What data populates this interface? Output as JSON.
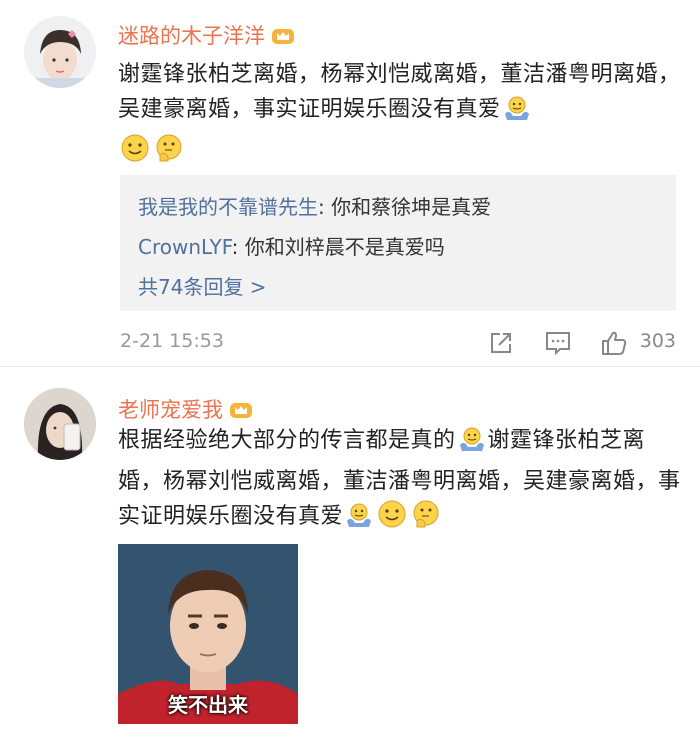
{
  "comments": [
    {
      "username": "迷路的木子洋洋",
      "text_main": "谢霆锋张柏芝离婚，杨幂刘恺威离婚，董洁潘粤明离婚，吴建豪离婚，事实证明娱乐圈没有真爱",
      "emojis": [
        "shrug-icon",
        "smile-icon",
        "thinking-icon"
      ],
      "replies": [
        {
          "name": "我是我的不靠谱先生",
          "text": ": 你和蔡徐坤是真爱"
        },
        {
          "name": "CrownLYF",
          "text": ": 你和刘梓晨不是真爱吗"
        }
      ],
      "more_replies": "共74条回复 >",
      "timestamp": "2-21 15:53",
      "likes": "303"
    },
    {
      "username": "老师宠爱我",
      "text_part1": "根据经验绝大部分的传言都是真的",
      "text_part2": "谢霆锋张柏芝离婚，杨幂刘恺威离婚，董洁潘粤明离婚，吴建豪离婚，事实证明娱乐圈没有真爱",
      "image_caption": "笑不出来"
    }
  ],
  "colors": {
    "username": "#eb7350",
    "reply_name": "#50719c",
    "meta": "#999999"
  }
}
